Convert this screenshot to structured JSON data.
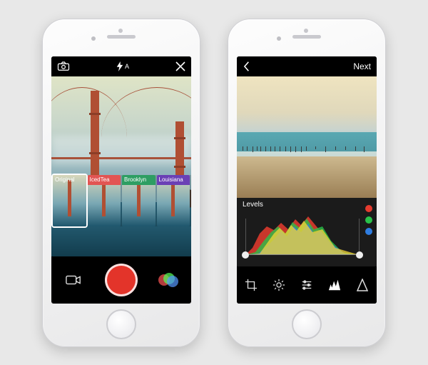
{
  "left": {
    "flash": "A",
    "filters": [
      {
        "label": "Original",
        "accent": "transparent",
        "selected": true
      },
      {
        "label": "IcedTea",
        "accent": "#e25553"
      },
      {
        "label": "Brooklyn",
        "accent": "#2e9e63"
      },
      {
        "label": "Louisiana",
        "accent": "#6a40b5"
      }
    ]
  },
  "right": {
    "next": "Next",
    "levels_label": "Levels",
    "channels": {
      "r": "#e63b2e",
      "g": "#29c24a",
      "b": "#2f7de1"
    },
    "tools": [
      "crop",
      "brightness",
      "sliders",
      "levels",
      "sharpen"
    ]
  }
}
